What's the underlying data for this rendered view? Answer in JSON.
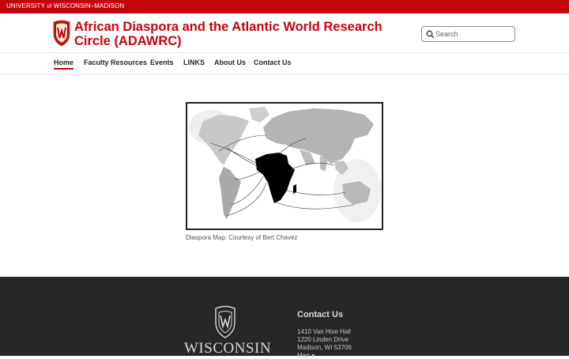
{
  "topbar": {
    "university_prefix": "UNIVERSITY",
    "of": "of",
    "university_name": "WISCONSIN–MADISON"
  },
  "header": {
    "title_line1": "African Diaspora and the Atlantic World Research",
    "title_line2": "Circle (ADAWRC)",
    "search_placeholder": "Search"
  },
  "nav": {
    "items": [
      {
        "label": "Home",
        "active": true
      },
      {
        "label": "Faculty Resources",
        "active": false
      },
      {
        "label": "Events",
        "active": false
      },
      {
        "label": "LINKS",
        "active": false
      },
      {
        "label": "About Us",
        "active": false
      },
      {
        "label": "Contact Us",
        "active": false
      }
    ]
  },
  "main": {
    "map_caption": "Diaspora Map: Courtesy of Bert Chavez"
  },
  "footer": {
    "wordmark": "WISCONSIN",
    "contact_heading": "Contact Us",
    "address_line1": "1410 Van Hise Hall",
    "address_line2": "1220 Linden Drive",
    "address_line3": "Madison, WI 53706",
    "map_link": "Map"
  },
  "colors": {
    "brand_red": "#c5050c",
    "footer_bg": "#282728"
  },
  "icons": [
    "uw-crest-icon",
    "search-icon",
    "map-pin-icon"
  ]
}
